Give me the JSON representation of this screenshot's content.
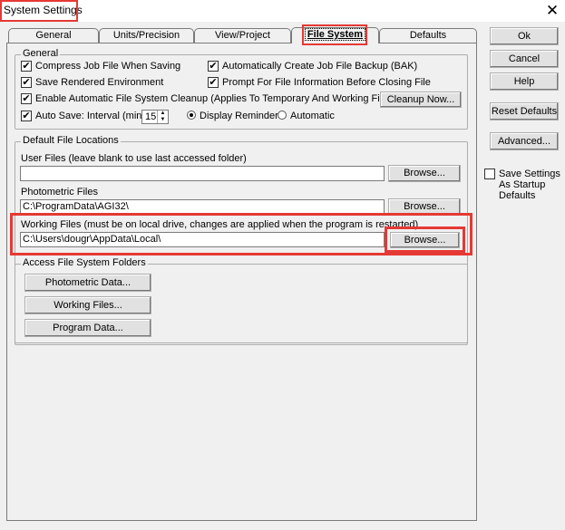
{
  "window": {
    "title": "System Settings",
    "close": "✕"
  },
  "tabs": [
    {
      "label": "General"
    },
    {
      "label": "Units/Precision"
    },
    {
      "label": "View/Project"
    },
    {
      "label": "File System"
    },
    {
      "label": "Defaults"
    }
  ],
  "general": {
    "group_label": "General",
    "compress": {
      "label": "Compress Job File When Saving",
      "checked": "✔"
    },
    "auto_backup": {
      "label": "Automatically Create Job File Backup (BAK)",
      "checked": "✔"
    },
    "save_rendered": {
      "label": "Save Rendered Environment",
      "checked": "✔"
    },
    "prompt_info": {
      "label": "Prompt For File Information Before Closing File",
      "checked": "✔"
    },
    "cleanup": {
      "label": "Enable Automatic File System Cleanup (Applies To Temporary And Working Files Only)",
      "checked": "✔"
    },
    "cleanup_button": "Cleanup Now...",
    "autosave": {
      "label": "Auto Save: Interval (min.)",
      "checked": "✔",
      "interval": "15"
    },
    "display_reminder": "Display Reminder",
    "automatic": "Automatic"
  },
  "locations": {
    "group_label": "Default File Locations",
    "user_files": {
      "label": "User Files (leave blank to use last accessed folder)",
      "value": ""
    },
    "photometric_files": {
      "label": "Photometric Files",
      "value": "C:\\ProgramData\\AGI32\\"
    },
    "working_files": {
      "label": "Working Files (must be on local drive, changes are applied when the program is restarted)",
      "value": "C:\\Users\\dougr\\AppData\\Local\\"
    },
    "browse": "Browse..."
  },
  "access": {
    "group_label": "Access File System Folders",
    "photometric_data": "Photometric Data...",
    "working_files": "Working Files...",
    "program_data": "Program Data..."
  },
  "side": {
    "ok": "Ok",
    "cancel": "Cancel",
    "help": "Help",
    "reset_defaults": "Reset Defaults",
    "advanced": "Advanced...",
    "save_startup": "Save Settings As Startup Defaults"
  }
}
